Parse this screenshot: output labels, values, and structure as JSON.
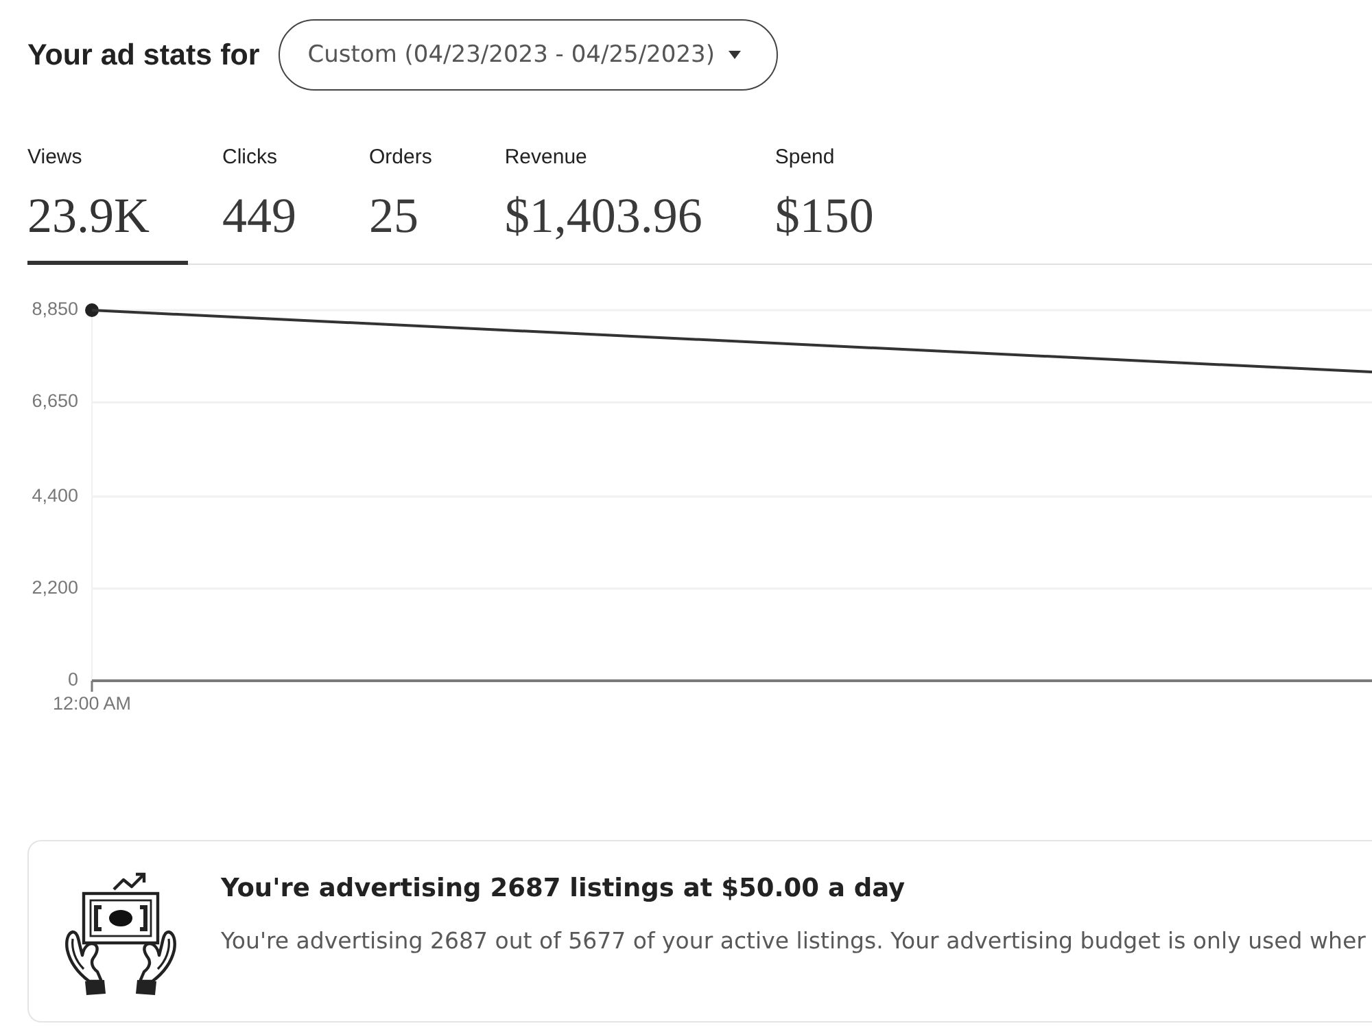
{
  "header": {
    "title": "Your ad stats for",
    "date_range": {
      "label": "Custom (04/23/2023 - 04/25/2023)"
    }
  },
  "stats_tabs": [
    {
      "label": "Views",
      "value": "23.9K",
      "selected": true
    },
    {
      "label": "Clicks",
      "value": "449",
      "selected": false
    },
    {
      "label": "Orders",
      "value": "25",
      "selected": false
    },
    {
      "label": "Revenue",
      "value": "$1,403.96",
      "selected": false
    },
    {
      "label": "Spend",
      "value": "$150",
      "selected": false
    }
  ],
  "chart": {
    "chart_data": {
      "type": "line",
      "categories": [
        "12:00 AM"
      ],
      "values": [
        8850
      ],
      "marker": true,
      "ylim": [
        0,
        8850
      ],
      "yticks": [
        {
          "value": 0,
          "label": "0"
        },
        {
          "value": 2200,
          "label": "2,200"
        },
        {
          "value": 4400,
          "label": "4,400"
        },
        {
          "value": 6650,
          "label": "6,650"
        },
        {
          "value": 8850,
          "label": "8,850"
        }
      ],
      "grid": true
    }
  },
  "budget_card": {
    "title": "You're advertising 2687 listings at $50.00 a day",
    "description": "You're advertising 2687 out of 5677 of your active listings. Your advertising budget is only used wher"
  }
}
